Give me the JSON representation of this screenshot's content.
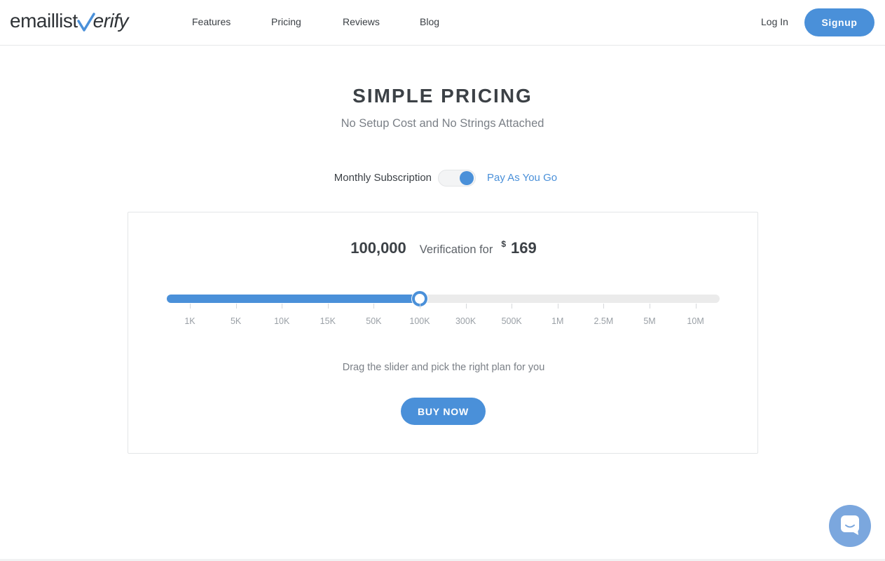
{
  "header": {
    "logo_prefix": "emaillist",
    "logo_suffix": "erify",
    "nav": [
      {
        "label": "Features"
      },
      {
        "label": "Pricing"
      },
      {
        "label": "Reviews"
      },
      {
        "label": "Blog"
      }
    ],
    "login_label": "Log In",
    "signup_label": "Signup"
  },
  "hero": {
    "title": "SIMPLE PRICING",
    "subtitle": "No Setup Cost and No Strings Attached"
  },
  "toggle": {
    "left_label": "Monthly Subscription",
    "right_label": "Pay As You Go",
    "selected": "Pay As You Go"
  },
  "pricing": {
    "count": "100,000",
    "for_text": "Verification for",
    "currency": "$",
    "amount": "169",
    "slider": {
      "ticks": [
        "1K",
        "5K",
        "10K",
        "15K",
        "50K",
        "100K",
        "300K",
        "500K",
        "1M",
        "2.5M",
        "5M",
        "10M"
      ],
      "selected_index": 5,
      "selected_label": "100K"
    },
    "hint": "Drag the slider and pick the right plan for you",
    "buy_label": "BUY NOW"
  },
  "colors": {
    "accent": "#4a90d9",
    "text": "#3c4146",
    "muted": "#7b8087",
    "track": "#ebebeb"
  },
  "icons": {
    "logo_mark": "checkmark-icon",
    "chat": "chat-bubble-icon"
  }
}
